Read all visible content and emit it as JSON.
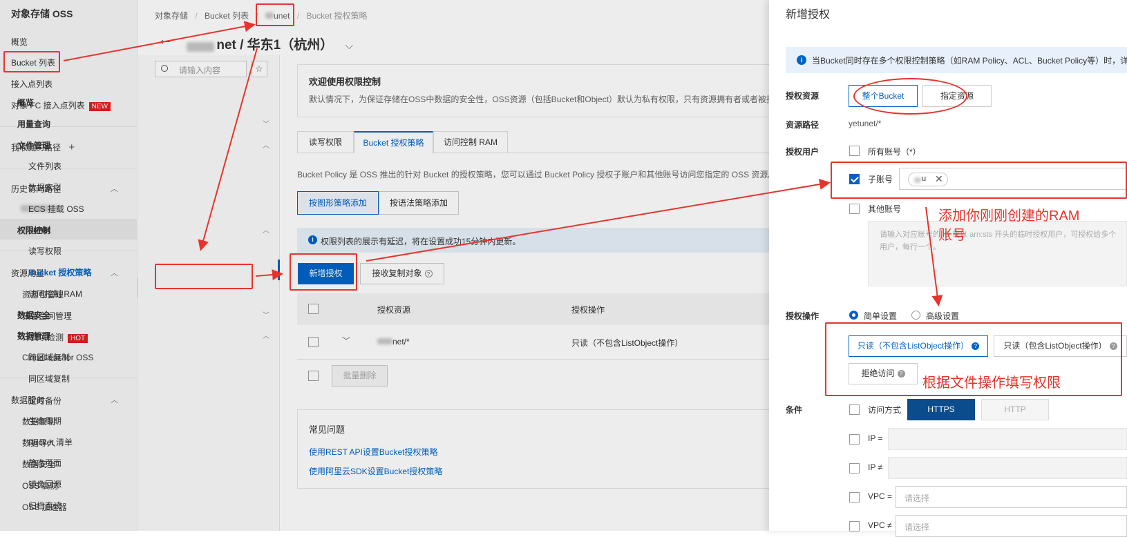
{
  "sidebar": {
    "title": "对象存储 OSS",
    "items": [
      "概览",
      "Bucket 列表",
      "接入点列表",
      "对象 FC 接入点列表"
    ],
    "new_badge": "NEW",
    "favorites": "我收藏的路径",
    "favorites_add": "+",
    "history": "历史访问路径",
    "history_items": [
      "unet"
    ],
    "resources": "资源用量",
    "resource_items": [
      "资源包管理",
      "预留空间管理",
      "计费项检测",
      "CloudLens for OSS"
    ],
    "hot_badge": "HOT",
    "data_service": "数据服务",
    "data_items": [
      "数据复制",
      "数据导入",
      "数据安全",
      "OSS 高防",
      "OSS 加速器"
    ]
  },
  "breadcrumb": [
    "对象存储",
    "Bucket 列表",
    "unet",
    "Bucket 授权策略"
  ],
  "header": {
    "back": "←",
    "title": "net / 华东1（杭州）",
    "dropdown": "⌵"
  },
  "nav2": {
    "search_placeholder": "请输入内容",
    "overview": "概览",
    "sections": [
      "用量查询",
      "文件管理",
      "权限控制",
      "数据安全",
      "数据管理"
    ],
    "file_items": [
      "文件列表",
      "数据索引",
      "ECS 挂载 OSS"
    ],
    "perm_items": [
      "读写权限",
      "Bucket 授权策略",
      "访问控制 RAM"
    ],
    "data_items": [
      "跨区域复制",
      "同区域复制",
      "定时备份",
      "生命周期",
      "Bucket 清单",
      "静态页面",
      "镜像回源",
      "归档直读"
    ]
  },
  "main": {
    "welcome_title": "欢迎使用权限控制",
    "welcome_text": "默认情况下，为保证存储在OSS中数据的安全性，OSS资源（包括Bucket和Object）默认为私有权限，只有资源拥有者或者被授",
    "tabs": [
      "读写权限",
      "Bucket 授权策略",
      "访问控制 RAM"
    ],
    "policy_desc": "Bucket Policy 是 OSS 推出的针对 Bucket 的授权策略，您可以通过 Bucket Policy 授权子账户和其他账号访问您指定的 OSS 资源。",
    "add_graphic": "按图形策略添加",
    "add_syntax": "按语法策略添加",
    "notice": "权限列表的展示有延迟，将在设置成功15分钟内更新。",
    "new_auth": "新增授权",
    "receive_copy": "接收复制对象",
    "table_headers": [
      "授权资源",
      "授权操作"
    ],
    "row": {
      "resource": "net/*",
      "operation": "只读（不包含ListObject操作）"
    },
    "batch_delete": "批量删除",
    "faq_title": "常见问题",
    "faq_links": [
      "使用REST API设置Bucket授权策略",
      "使用阿里云SDK设置Bucket授权策略"
    ]
  },
  "panel": {
    "title": "新增授权",
    "info": "当Bucket同时存在多个权限控制策略（如RAM Policy、ACL、Bucket Policy等）时，详",
    "resource_label": "授权资源",
    "resource_opts": [
      "整个Bucket",
      "指定资源"
    ],
    "path_label": "资源路径",
    "path_value": "yetunet/*",
    "user_label": "授权用户",
    "all_accounts": "所有账号（*）",
    "sub_account": "子账号",
    "sub_tag": "u",
    "other_account": "其他账号",
    "other_placeholder": "请输入对应账号的 ID 或以 arn:sts 开头的临时授权用户，可授权给多个用户，每行一个。",
    "op_label": "授权操作",
    "op_modes": [
      "简单设置",
      "高级设置"
    ],
    "op_opts": [
      "只读（不包含ListObject操作）",
      "只读（包含ListObject操作）",
      "拒绝访问"
    ],
    "cond_label": "条件",
    "access_method": "访问方式",
    "https": "HTTPS",
    "http": "HTTP",
    "ip_eq": "IP =",
    "ip_ne": "IP ≠",
    "vpc_eq": "VPC =",
    "vpc_ne": "VPC ≠",
    "select_placeholder": "请选择"
  },
  "annotations": {
    "add_ram": "添加你刚刚创建的RAM",
    "add_ram2": "账号",
    "fill_perm": "根据文件操作填写权限"
  },
  "colors": {
    "primary": "#0064c8",
    "annotation": "#e8332b",
    "link": "#0064c8"
  }
}
